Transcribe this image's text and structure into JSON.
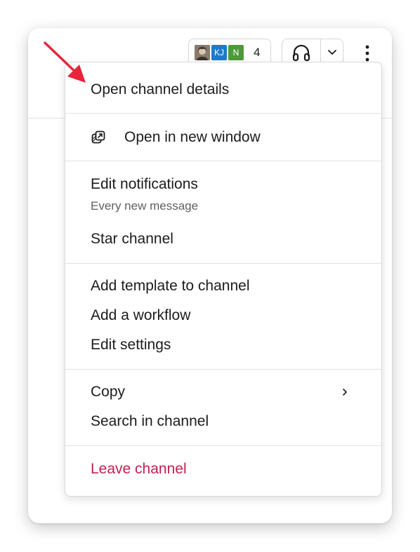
{
  "header": {
    "member_avatars": [
      {
        "label": "",
        "type": "photo"
      },
      {
        "label": "KJ",
        "color": "#1d7bc9"
      },
      {
        "label": "N",
        "color": "#4e9a3a"
      }
    ],
    "member_count": "4",
    "huddle_icon": "headphones-icon",
    "huddle_menu_icon": "chevron-down-icon",
    "more_icon": "kebab-icon"
  },
  "menu": {
    "open_channel_details": "Open channel details",
    "open_in_new_window": "Open in new window",
    "open_in_new_window_icon": "new-window-icon",
    "edit_notifications": "Edit notifications",
    "notifications_value": "Every new message",
    "star_channel": "Star channel",
    "add_template": "Add template to channel",
    "add_workflow": "Add a workflow",
    "edit_settings": "Edit settings",
    "copy": "Copy",
    "copy_submenu_icon": "chevron-right-icon",
    "search_in_channel": "Search in channel",
    "leave_channel": "Leave channel"
  },
  "colors": {
    "danger": "#c41e50",
    "annotation_arrow": "#e8243a",
    "text": "#1d1c1d",
    "muted_text": "#616061"
  }
}
